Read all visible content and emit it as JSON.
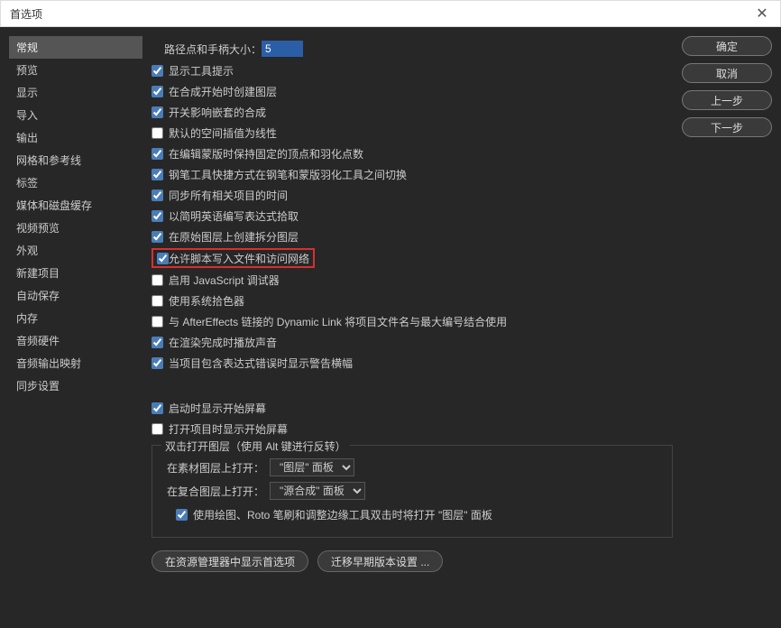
{
  "title": "首选项",
  "sidebar": {
    "items": [
      {
        "label": "常规"
      },
      {
        "label": "预览"
      },
      {
        "label": "显示"
      },
      {
        "label": "导入"
      },
      {
        "label": "输出"
      },
      {
        "label": "网格和参考线"
      },
      {
        "label": "标签"
      },
      {
        "label": "媒体和磁盘缓存"
      },
      {
        "label": "视频预览"
      },
      {
        "label": "外观"
      },
      {
        "label": "新建项目"
      },
      {
        "label": "自动保存"
      },
      {
        "label": "内存"
      },
      {
        "label": "音频硬件"
      },
      {
        "label": "音频输出映射"
      },
      {
        "label": "同步设置"
      }
    ]
  },
  "main": {
    "pathLabel": "路径点和手柄大小：",
    "pathValue": "5",
    "checks": [
      {
        "label": "显示工具提示",
        "checked": true
      },
      {
        "label": "在合成开始时创建图层",
        "checked": true
      },
      {
        "label": "开关影响嵌套的合成",
        "checked": true
      },
      {
        "label": "默认的空间插值为线性",
        "checked": false
      },
      {
        "label": "在编辑蒙版时保持固定的顶点和羽化点数",
        "checked": true
      },
      {
        "label": "钢笔工具快捷方式在钢笔和蒙版羽化工具之间切换",
        "checked": true
      },
      {
        "label": "同步所有相关项目的时间",
        "checked": true
      },
      {
        "label": "以简明英语编写表达式拾取",
        "checked": true
      },
      {
        "label": "在原始图层上创建拆分图层",
        "checked": true
      },
      {
        "label": "允许脚本写入文件和访问网络",
        "checked": true,
        "highlight": true
      },
      {
        "label": "启用 JavaScript 调试器",
        "checked": false
      },
      {
        "label": "使用系统拾色器",
        "checked": false
      },
      {
        "label": "与 AfterEffects 链接的 Dynamic Link 将项目文件名与最大编号结合使用",
        "checked": false
      },
      {
        "label": "在渲染完成时播放声音",
        "checked": true
      },
      {
        "label": "当项目包含表达式错误时显示警告横幅",
        "checked": true
      }
    ],
    "startup": [
      {
        "label": "启动时显示开始屏幕",
        "checked": true
      },
      {
        "label": "打开项目时显示开始屏幕",
        "checked": false
      }
    ],
    "group": {
      "title": "双击打开图层（使用 Alt 键进行反转）",
      "row1Label": "在素材图层上打开：",
      "row1Value": "\"图层\" 面板",
      "row2Label": "在复合图层上打开：",
      "row2Value": "\"源合成\" 面板",
      "paintCheck": {
        "label": "使用绘图、Roto 笔刷和调整边缘工具双击时将打开 \"图层\" 面板",
        "checked": true
      }
    },
    "bottom": {
      "btn1": "在资源管理器中显示首选项",
      "btn2": "迁移早期版本设置 ..."
    }
  },
  "buttons": {
    "ok": "确定",
    "cancel": "取消",
    "prev": "上一步",
    "next": "下一步"
  }
}
